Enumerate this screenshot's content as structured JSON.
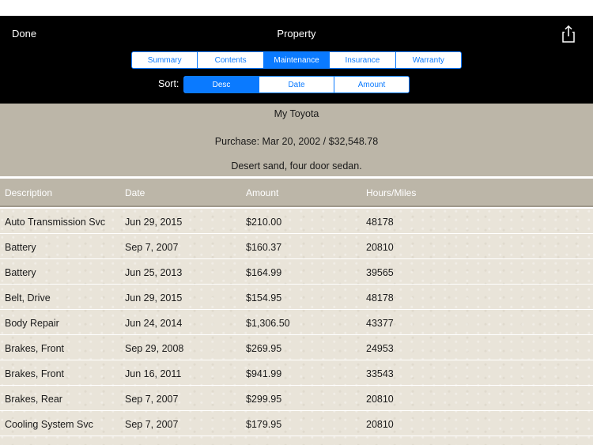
{
  "nav": {
    "done_label": "Done",
    "title": "Property"
  },
  "tabs": [
    {
      "label": "Summary",
      "active": false
    },
    {
      "label": "Contents",
      "active": false
    },
    {
      "label": "Maintenance",
      "active": true
    },
    {
      "label": "Insurance",
      "active": false
    },
    {
      "label": "Warranty",
      "active": false
    }
  ],
  "sort": {
    "label": "Sort:",
    "options": [
      {
        "label": "Desc",
        "active": true
      },
      {
        "label": "Date",
        "active": false
      },
      {
        "label": "Amount",
        "active": false
      }
    ]
  },
  "item": {
    "name": "My Toyota",
    "purchase": "Purchase: Mar 20, 2002 / $32,548.78",
    "description": "Desert sand, four door sedan."
  },
  "table": {
    "columns": [
      "Description",
      "Date",
      "Amount",
      "Hours/Miles"
    ],
    "rows": [
      [
        "Auto Transmission Svc",
        "Jun 29, 2015",
        "$210.00",
        "48178"
      ],
      [
        "Battery",
        "Sep 7, 2007",
        "$160.37",
        "20810"
      ],
      [
        "Battery",
        "Jun 25, 2013",
        "$164.99",
        "39565"
      ],
      [
        "Belt, Drive",
        "Jun 29, 2015",
        "$154.95",
        "48178"
      ],
      [
        "Body Repair",
        "Jun 24, 2014",
        "$1,306.50",
        "43377"
      ],
      [
        "Brakes, Front",
        "Sep 29, 2008",
        "$269.95",
        "24953"
      ],
      [
        "Brakes, Front",
        "Jun 16, 2011",
        "$941.99",
        "33543"
      ],
      [
        "Brakes, Rear",
        "Sep 7, 2007",
        "$299.95",
        "20810"
      ],
      [
        "Cooling System Svc",
        "Sep 7, 2007",
        "$179.95",
        "20810"
      ]
    ]
  },
  "colors": {
    "accent": "#0a7aff",
    "navbar": "#000000",
    "header_bg": "#bcb6a8",
    "table_bg": "#e9e4d9"
  },
  "icons": {
    "share": "share-icon"
  }
}
